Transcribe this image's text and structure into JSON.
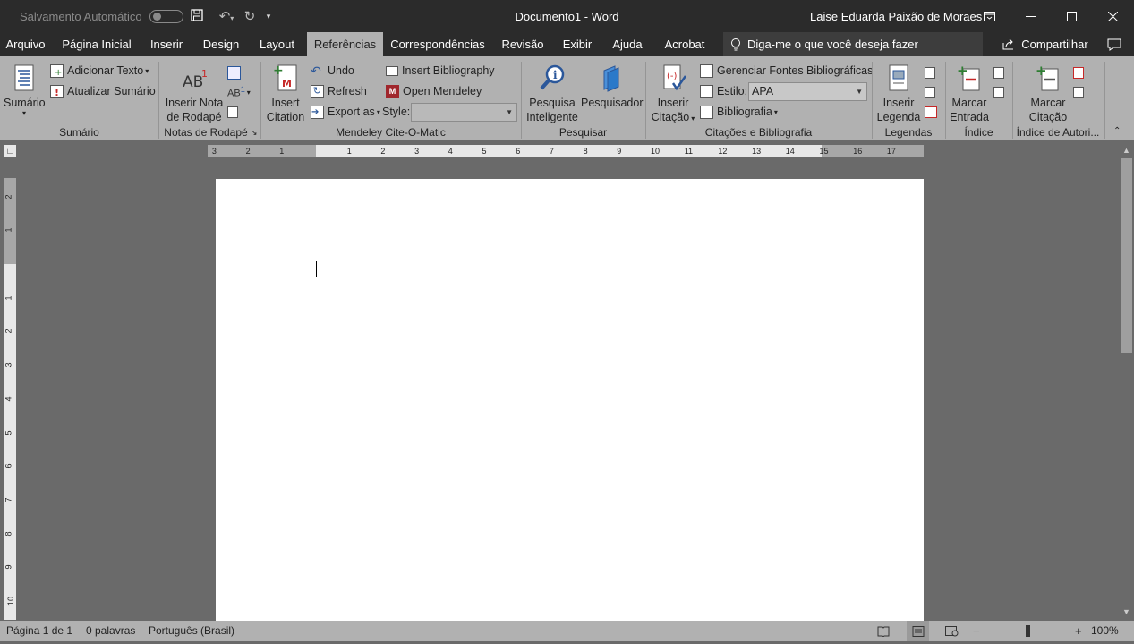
{
  "titlebar": {
    "autosave_label": "Salvamento Automático",
    "doc_title": "Documento1  -  Word",
    "user": "Laise Eduarda Paixão de Moraes",
    "qat_icons": [
      "save-icon",
      "undo-icon",
      "redo-icon",
      "customize-icon"
    ],
    "window_controls": [
      "ribbon-display-icon",
      "minimize-icon",
      "maximize-icon",
      "close-icon"
    ]
  },
  "tabs": [
    "Arquivo",
    "Página Inicial",
    "Inserir",
    "Design",
    "Layout",
    "Referências",
    "Correspondências",
    "Revisão",
    "Exibir",
    "Ajuda",
    "Acrobat"
  ],
  "active_tab": "Referências",
  "tellme": "Diga-me o que você deseja fazer",
  "share": "Compartilhar",
  "ribbon": {
    "sumario": {
      "big": "Sumário",
      "adicionar_texto": "Adicionar Texto",
      "atualizar_sumario": "Atualizar Sumário",
      "label": "Sumário"
    },
    "notas": {
      "big_line1": "Inserir Nota",
      "big_line2": "de Rodapé",
      "label": "Notas de Rodapé"
    },
    "mendeley": {
      "insert_line1": "Insert",
      "insert_line2": "Citation",
      "undo": "Undo",
      "refresh": "Refresh",
      "export_as": "Export as",
      "insert_bibliography": "Insert Bibliography",
      "open_mendeley": "Open Mendeley",
      "style_label": "Style:",
      "style_value": "",
      "label": "Mendeley Cite-O-Matic"
    },
    "pesquisar": {
      "pesquisa_line1": "Pesquisa",
      "pesquisa_line2": "Inteligente",
      "pesquisador": "Pesquisador",
      "label": "Pesquisar"
    },
    "citacoes": {
      "inserir_line1": "Inserir",
      "inserir_line2": "Citação",
      "gerenciar": "Gerenciar Fontes Bibliográficas",
      "estilo_label": "Estilo:",
      "estilo_value": "APA",
      "bibliografia": "Bibliografia",
      "label": "Citações e Bibliografia"
    },
    "legendas": {
      "inserir_line1": "Inserir",
      "inserir_line2": "Legenda",
      "label": "Legendas"
    },
    "indice": {
      "marcar_line1": "Marcar",
      "marcar_line2": "Entrada",
      "label": "Índice"
    },
    "autoridades": {
      "marcar_line1": "Marcar",
      "marcar_line2": "Citação",
      "label": "Índice de Autori..."
    }
  },
  "ruler": {
    "h_ticks": [
      "3",
      "2",
      "1",
      "1",
      "2",
      "3",
      "4",
      "5",
      "6",
      "7",
      "8",
      "9",
      "10",
      "11",
      "12",
      "13",
      "14",
      "15",
      "16",
      "17"
    ],
    "v_ticks": [
      "2",
      "1",
      "1",
      "2",
      "3",
      "4",
      "5",
      "6",
      "7",
      "8",
      "9",
      "10"
    ]
  },
  "status": {
    "page": "Página 1 de 1",
    "words": "0 palavras",
    "language": "Português (Brasil)",
    "zoom": "100%"
  }
}
